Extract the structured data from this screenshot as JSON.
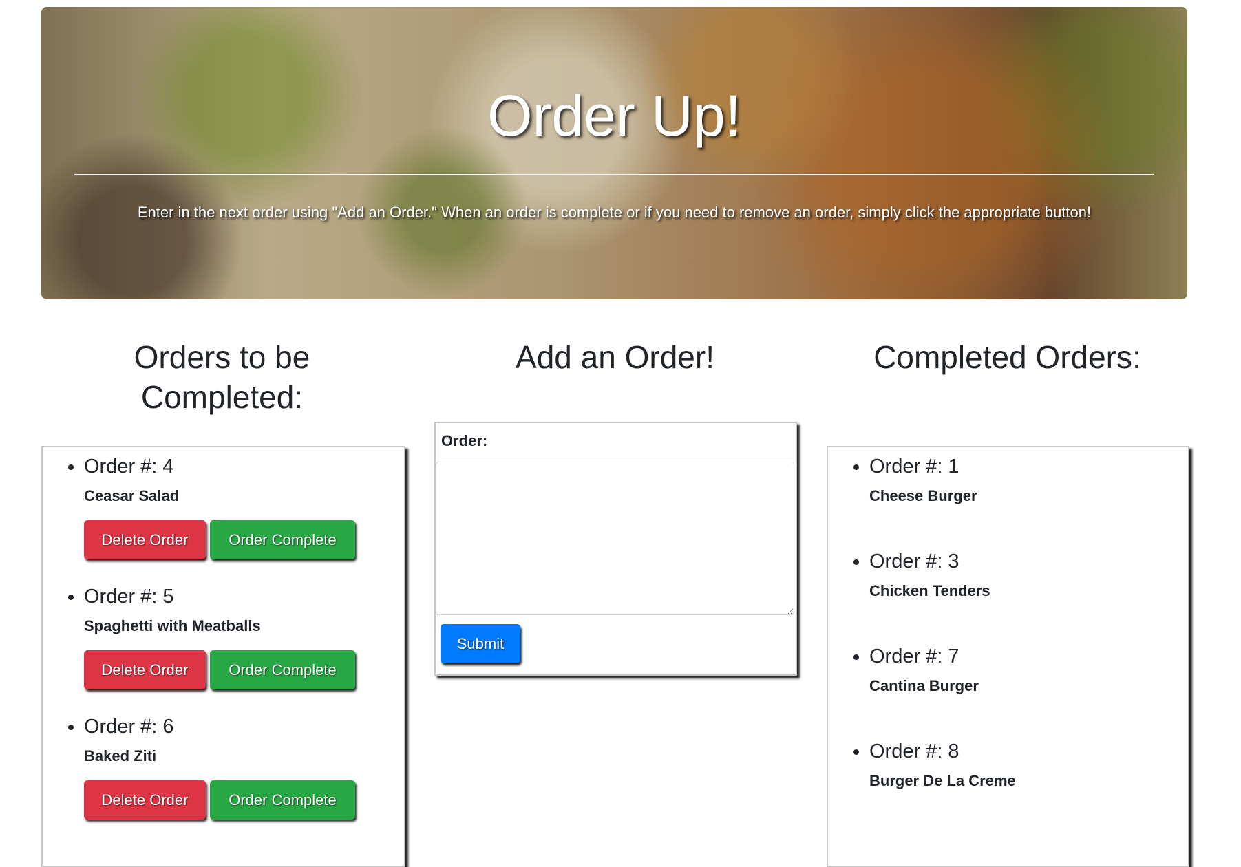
{
  "header": {
    "title": "Order Up!",
    "subtitle": "Enter in the next order using \"Add an Order.\" When an order is complete or if you need to remove an order, simply click the appropriate button!"
  },
  "pending": {
    "heading_line1": "Orders to be",
    "heading_line2": "Completed:",
    "delete_label": "Delete Order",
    "complete_label": "Order Complete",
    "orders": [
      {
        "number": "Order #: 4",
        "description": "Ceasar Salad"
      },
      {
        "number": "Order #: 5",
        "description": "Spaghetti with Meatballs"
      },
      {
        "number": "Order #: 6",
        "description": "Baked Ziti"
      }
    ]
  },
  "add_order": {
    "heading": "Add an Order!",
    "field_label": "Order:",
    "field_value": "",
    "submit_label": "Submit"
  },
  "completed": {
    "heading": "Completed Orders:",
    "orders": [
      {
        "number": "Order #: 1",
        "description": "Cheese Burger"
      },
      {
        "number": "Order #: 3",
        "description": "Chicken Tenders"
      },
      {
        "number": "Order #: 7",
        "description": "Cantina Burger"
      },
      {
        "number": "Order #: 8",
        "description": "Burger De La Creme"
      }
    ]
  },
  "colors": {
    "delete": "#dc3545",
    "complete": "#28a745",
    "submit": "#007bff"
  }
}
